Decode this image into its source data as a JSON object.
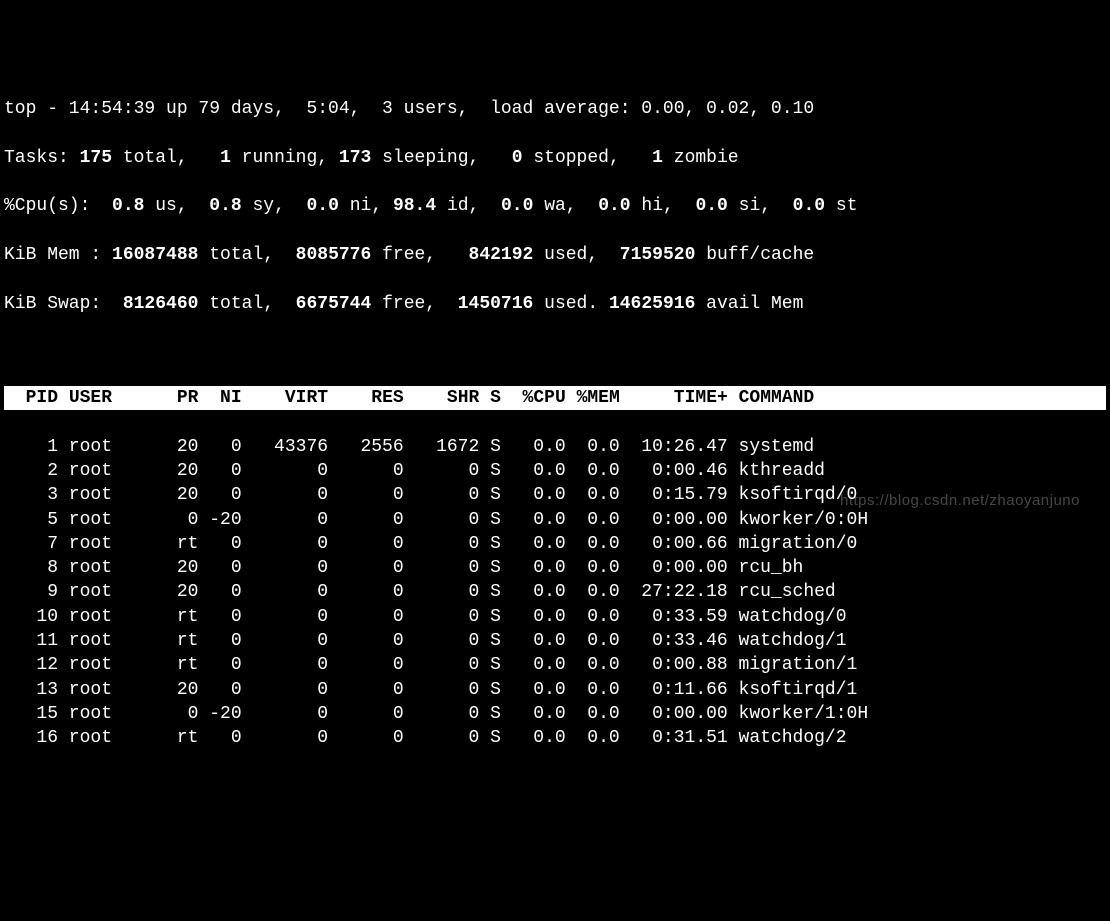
{
  "summary": {
    "line1_a": "top - 14:54:39 up 79 days,  5:04,  3 users,  load average: 0.00, 0.02, 0.10",
    "tasks_label": "Tasks: ",
    "tasks_total": "175 ",
    "tasks_total_l": "total,   ",
    "tasks_run": "1 ",
    "tasks_run_l": "running, ",
    "tasks_sleep": "173 ",
    "tasks_sleep_l": "sleeping,   ",
    "tasks_stop": "0 ",
    "tasks_stop_l": "stopped,   ",
    "tasks_zom": "1 ",
    "tasks_zom_l": "zombie",
    "cpu_label": "%Cpu(s):  ",
    "cpu_us": "0.8 ",
    "cpu_us_l": "us,  ",
    "cpu_sy": "0.8 ",
    "cpu_sy_l": "sy,  ",
    "cpu_ni": "0.0 ",
    "cpu_ni_l": "ni, ",
    "cpu_id": "98.4 ",
    "cpu_id_l": "id,  ",
    "cpu_wa": "0.0 ",
    "cpu_wa_l": "wa,  ",
    "cpu_hi": "0.0 ",
    "cpu_hi_l": "hi,  ",
    "cpu_si": "0.0 ",
    "cpu_si_l": "si,  ",
    "cpu_st": "0.0 ",
    "cpu_st_l": "st",
    "mem_label": "KiB Mem : ",
    "mem_total": "16087488 ",
    "mem_total_l": "total,  ",
    "mem_free": "8085776 ",
    "mem_free_l": "free,   ",
    "mem_used": "842192 ",
    "mem_used_l": "used,  ",
    "mem_buff": "7159520 ",
    "mem_buff_l": "buff/cache",
    "swap_label": "KiB Swap:  ",
    "swap_total": "8126460 ",
    "swap_total_l": "total,  ",
    "swap_free": "6675744 ",
    "swap_free_l": "free,  ",
    "swap_used": "1450716 ",
    "swap_used_l": "used. ",
    "swap_avail": "14625916 ",
    "swap_avail_l": "avail Mem "
  },
  "columns": {
    "pid": "  PID",
    "user": " USER    ",
    "pr": "  PR",
    "ni": "  NI",
    "virt": "    VIRT",
    "res": "    RES",
    "shr": "    SHR",
    "s": " S",
    "cpu": "  %CPU",
    "mem": " %MEM",
    "time": "     TIME+",
    "command": " COMMAND       "
  },
  "rows": [
    {
      "pid": "    1",
      "user": " root    ",
      "pr": "  20",
      "ni": "   0",
      "virt": "   43376",
      "res": "   2556",
      "shr": "   1672",
      "s": " S",
      "cpu": "   0.0",
      "mem": "  0.0",
      "time": "  10:26.47",
      "cmd": " systemd"
    },
    {
      "pid": "    2",
      "user": " root    ",
      "pr": "  20",
      "ni": "   0",
      "virt": "       0",
      "res": "      0",
      "shr": "      0",
      "s": " S",
      "cpu": "   0.0",
      "mem": "  0.0",
      "time": "   0:00.46",
      "cmd": " kthreadd"
    },
    {
      "pid": "    3",
      "user": " root    ",
      "pr": "  20",
      "ni": "   0",
      "virt": "       0",
      "res": "      0",
      "shr": "      0",
      "s": " S",
      "cpu": "   0.0",
      "mem": "  0.0",
      "time": "   0:15.79",
      "cmd": " ksoftirqd/0"
    },
    {
      "pid": "    5",
      "user": " root    ",
      "pr": "   0",
      "ni": " -20",
      "virt": "       0",
      "res": "      0",
      "shr": "      0",
      "s": " S",
      "cpu": "   0.0",
      "mem": "  0.0",
      "time": "   0:00.00",
      "cmd": " kworker/0:0H"
    },
    {
      "pid": "    7",
      "user": " root    ",
      "pr": "  rt",
      "ni": "   0",
      "virt": "       0",
      "res": "      0",
      "shr": "      0",
      "s": " S",
      "cpu": "   0.0",
      "mem": "  0.0",
      "time": "   0:00.66",
      "cmd": " migration/0"
    },
    {
      "pid": "    8",
      "user": " root    ",
      "pr": "  20",
      "ni": "   0",
      "virt": "       0",
      "res": "      0",
      "shr": "      0",
      "s": " S",
      "cpu": "   0.0",
      "mem": "  0.0",
      "time": "   0:00.00",
      "cmd": " rcu_bh"
    },
    {
      "pid": "    9",
      "user": " root    ",
      "pr": "  20",
      "ni": "   0",
      "virt": "       0",
      "res": "      0",
      "shr": "      0",
      "s": " S",
      "cpu": "   0.0",
      "mem": "  0.0",
      "time": "  27:22.18",
      "cmd": " rcu_sched"
    },
    {
      "pid": "   10",
      "user": " root    ",
      "pr": "  rt",
      "ni": "   0",
      "virt": "       0",
      "res": "      0",
      "shr": "      0",
      "s": " S",
      "cpu": "   0.0",
      "mem": "  0.0",
      "time": "   0:33.59",
      "cmd": " watchdog/0"
    },
    {
      "pid": "   11",
      "user": " root    ",
      "pr": "  rt",
      "ni": "   0",
      "virt": "       0",
      "res": "      0",
      "shr": "      0",
      "s": " S",
      "cpu": "   0.0",
      "mem": "  0.0",
      "time": "   0:33.46",
      "cmd": " watchdog/1"
    },
    {
      "pid": "   12",
      "user": " root    ",
      "pr": "  rt",
      "ni": "   0",
      "virt": "       0",
      "res": "      0",
      "shr": "      0",
      "s": " S",
      "cpu": "   0.0",
      "mem": "  0.0",
      "time": "   0:00.88",
      "cmd": " migration/1"
    },
    {
      "pid": "   13",
      "user": " root    ",
      "pr": "  20",
      "ni": "   0",
      "virt": "       0",
      "res": "      0",
      "shr": "      0",
      "s": " S",
      "cpu": "   0.0",
      "mem": "  0.0",
      "time": "   0:11.66",
      "cmd": " ksoftirqd/1"
    },
    {
      "pid": "   15",
      "user": " root    ",
      "pr": "   0",
      "ni": " -20",
      "virt": "       0",
      "res": "      0",
      "shr": "      0",
      "s": " S",
      "cpu": "   0.0",
      "mem": "  0.0",
      "time": "   0:00.00",
      "cmd": " kworker/1:0H"
    },
    {
      "pid": "   16",
      "user": " root    ",
      "pr": "  rt",
      "ni": "   0",
      "virt": "       0",
      "res": "      0",
      "shr": "      0",
      "s": " S",
      "cpu": "   0.0",
      "mem": "  0.0",
      "time": "   0:31.51",
      "cmd": " watchdog/2"
    }
  ],
  "watermark": "https://blog.csdn.net/zhaoyanjuno"
}
